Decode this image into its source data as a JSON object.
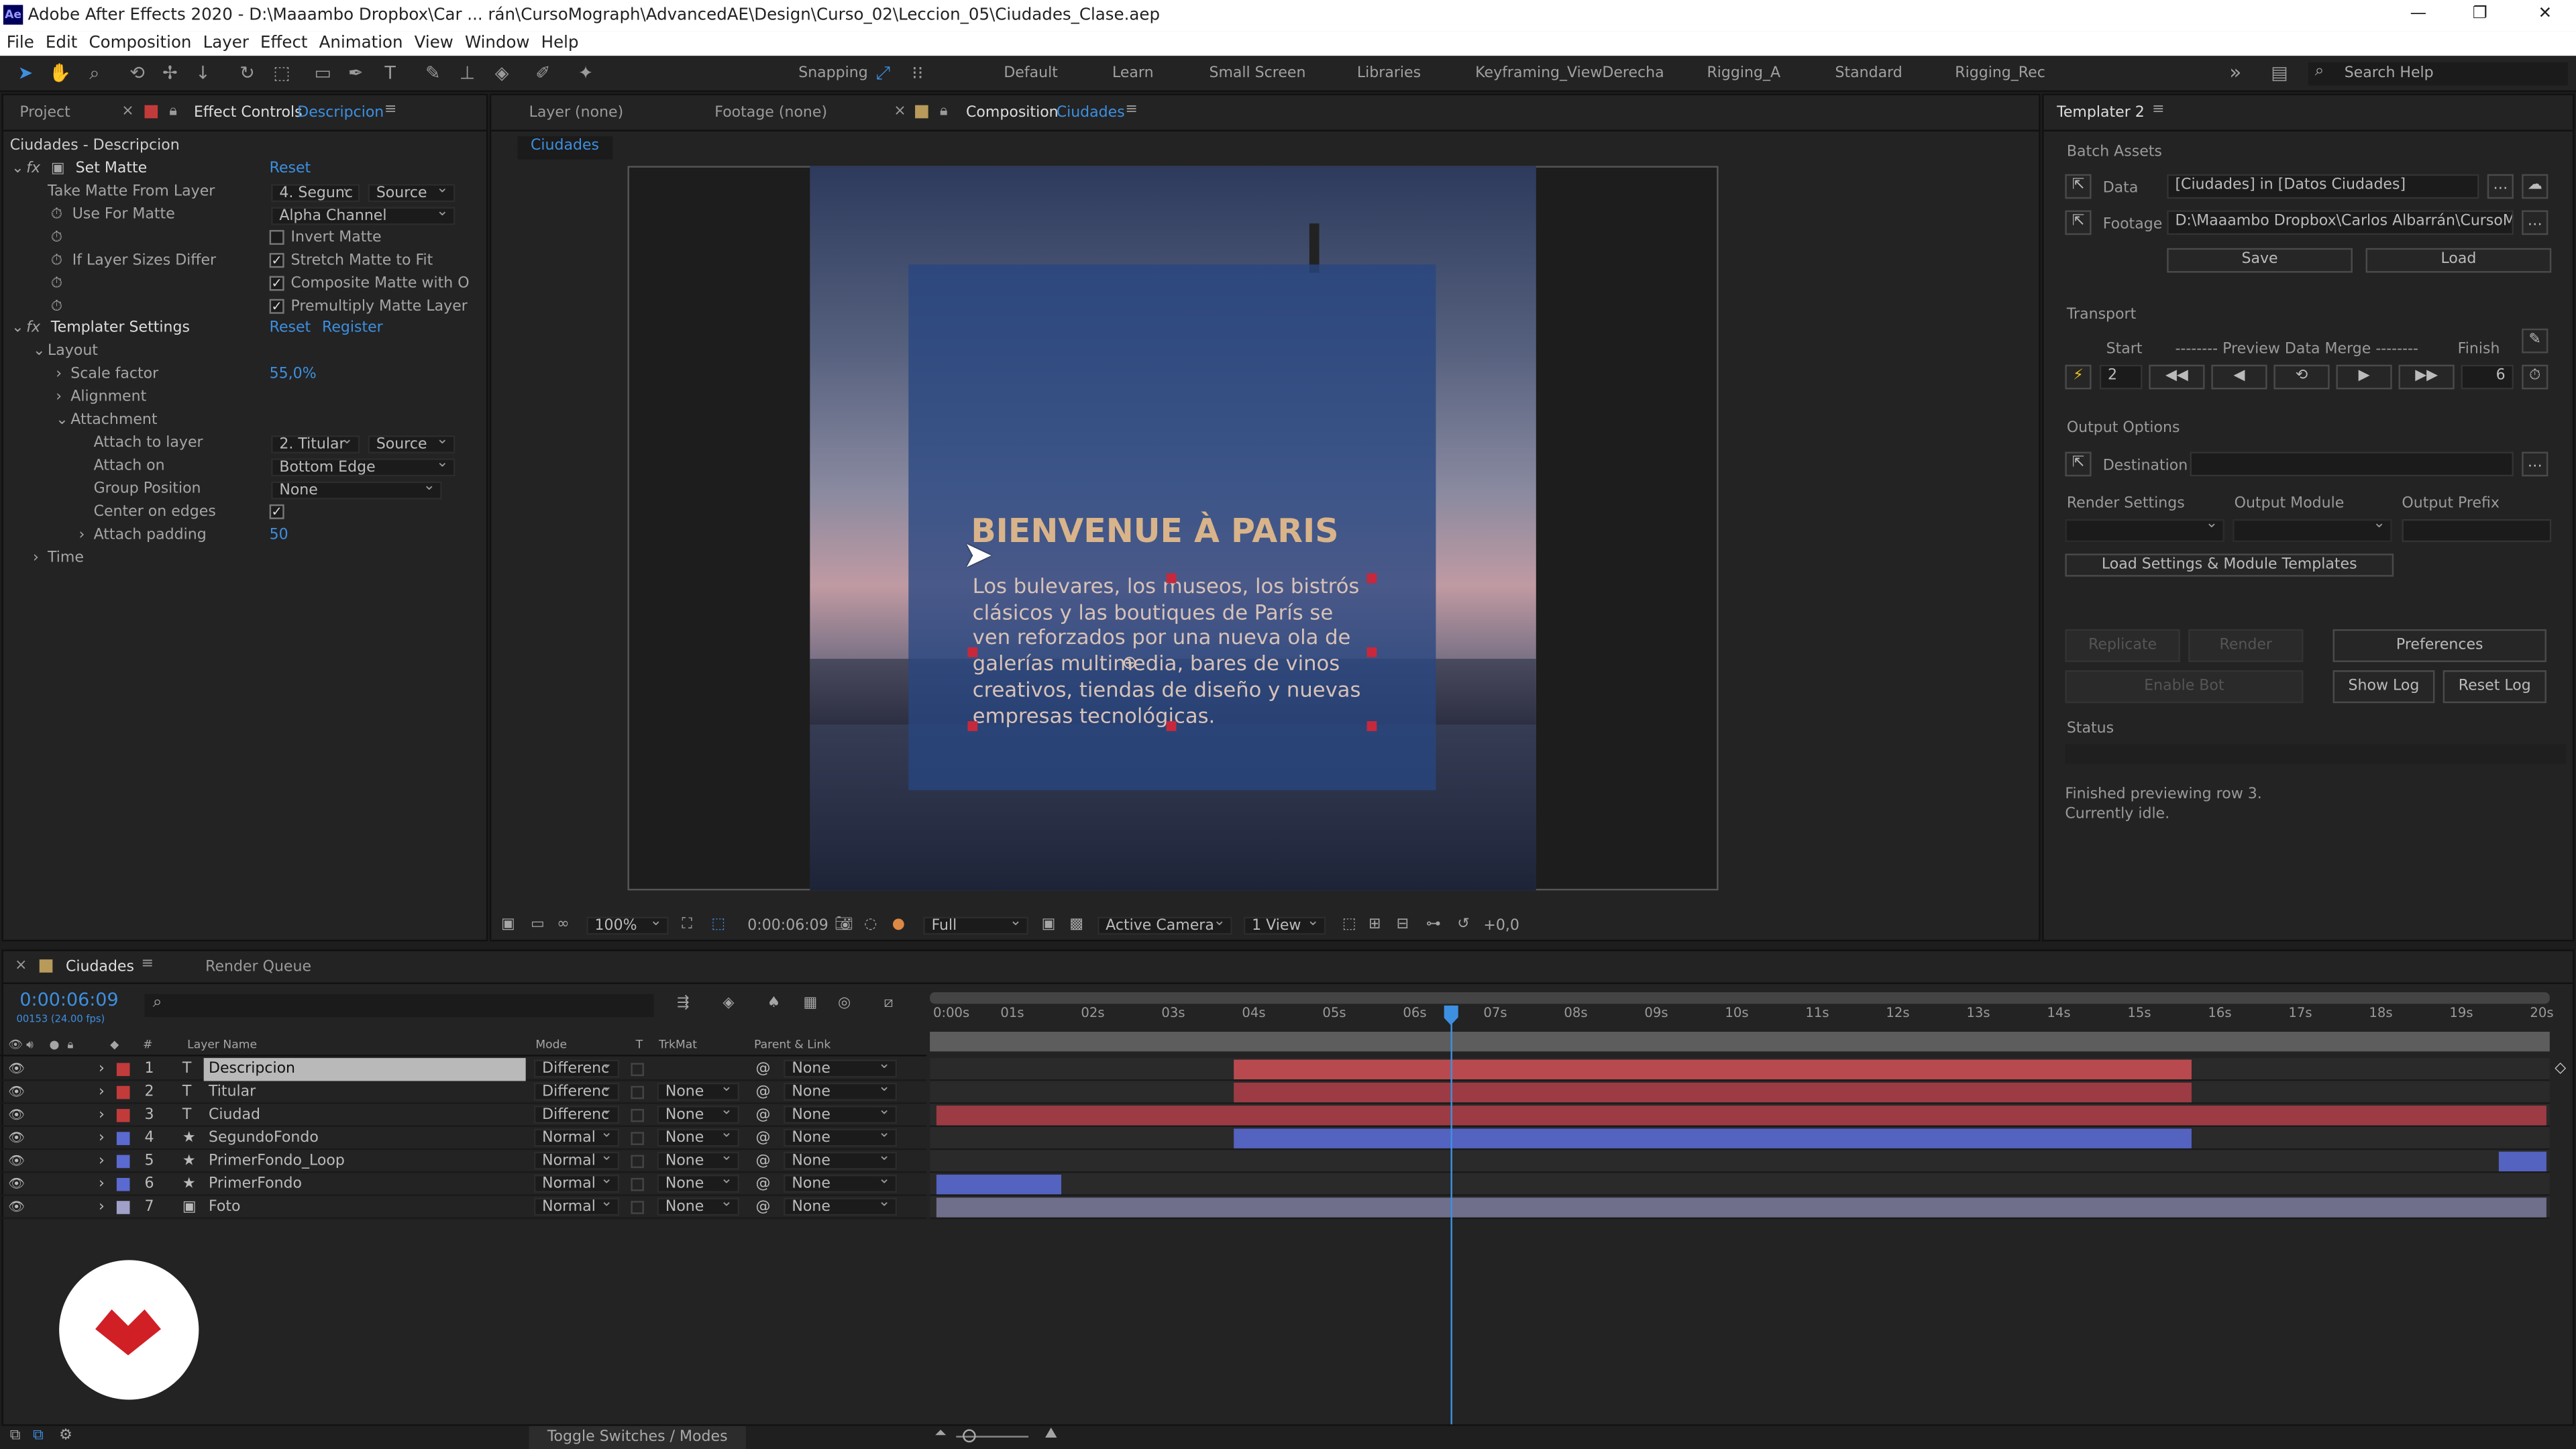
{
  "window": {
    "title": "Adobe After Effects 2020 - D:\\Maaambo Dropbox\\Car ... rán\\CursoMograph\\AdvancedAE\\Design\\Curso_02\\Leccion_05\\Ciudades_Clase.aep",
    "app_badge": "Ae",
    "min": "—",
    "max": "❐",
    "close": "✕"
  },
  "menu": [
    "File",
    "Edit",
    "Composition",
    "Layer",
    "Effect",
    "Animation",
    "View",
    "Window",
    "Help"
  ],
  "toolbar": {
    "snapping": "Snapping",
    "workspaces": [
      "Default",
      "Learn",
      "Small Screen",
      "Libraries",
      "Keyframing_ViewDerecha",
      "Rigging_A",
      "Standard",
      "Rigging_Rec"
    ],
    "more": "»",
    "search_placeholder": "Search Help"
  },
  "left_panel": {
    "tab_project": "Project",
    "tab_effect_controls": "Effect Controls",
    "tab_effect_target": "Descripcion",
    "breadcrumb": "Ciudades - Descripcion",
    "set_matte": {
      "fx": "fx",
      "name": "Set Matte",
      "reset": "Reset",
      "take_matte_label": "Take Matte From Layer",
      "take_matte_value": "4. Segunc",
      "take_matte_src": "Source",
      "use_for_matte_label": "Use For Matte",
      "use_for_matte_value": "Alpha Channel",
      "invert_matte": "Invert Matte",
      "if_layer_sizes": "If Layer Sizes Differ",
      "stretch": "Stretch Matte to Fit",
      "composite": "Composite Matte with O",
      "premultiply": "Premultiply Matte Layer"
    },
    "templater": {
      "fx": "fx",
      "name": "Templater Settings",
      "reset": "Reset",
      "register": "Register",
      "layout": "Layout",
      "scale_label": "Scale factor",
      "scale_value": "55,0%",
      "alignment": "Alignment",
      "attachment": "Attachment",
      "attach_to_label": "Attach to layer",
      "attach_to_value": "2. Titular",
      "attach_to_src": "Source",
      "attach_on_label": "Attach on",
      "attach_on_value": "Bottom Edge",
      "group_label": "Group Position",
      "group_value": "None",
      "center_label": "Center on edges",
      "padding_label": "Attach padding",
      "padding_value": "50",
      "time": "Time"
    }
  },
  "viewer": {
    "tab_layer": "Layer  (none)",
    "tab_footage": "Footage  (none)",
    "tab_comp": "Composition",
    "comp_name": "Ciudades",
    "comp_subtab": "Ciudades",
    "headline": "BIENVENUE À PARIS",
    "body": "Los bulevares, los museos, los bistrós clásicos y las boutiques de París se ven reforzados por una nueva ola de galerías multimedia, bares de vinos creativos, tiendas de diseño y nuevas empresas tecnológicas.",
    "zoom": "100%",
    "timecode": "0:00:06:09",
    "quality": "Full",
    "camera": "Active Camera",
    "views": "1 View",
    "exposure": "+0,0"
  },
  "templater_panel": {
    "title": "Templater 2",
    "batch_assets": "Batch Assets",
    "data_label": "Data",
    "data_value": "[Ciudades] in [Datos Ciudades]",
    "footage_label": "Footage",
    "footage_value": "D:\\Maaambo Dropbox\\Carlos Albarrán\\CursoMogra",
    "save": "Save",
    "load": "Load",
    "transport": "Transport",
    "start": "Start",
    "preview_label": "-------- Preview Data Merge --------",
    "finish": "Finish",
    "start_value": "2",
    "finish_value": "6",
    "output_options": "Output Options",
    "destination": "Destination",
    "render_settings": "Render Settings",
    "output_module": "Output Module",
    "output_prefix": "Output Prefix",
    "load_settings": "Load Settings & Module Templates",
    "replicate": "Replicate",
    "render": "Render",
    "preferences": "Preferences",
    "enable_bot": "Enable Bot",
    "show_log": "Show Log",
    "reset_log": "Reset Log",
    "status": "Status",
    "status_line1": "Finished previewing row 3.",
    "status_line2": "Currently idle."
  },
  "timeline": {
    "tab_comp": "Ciudades",
    "tab_render": "Render Queue",
    "timecode": "0:00:06:09",
    "fps": "00153 (24.00 fps)",
    "col_layer": "Layer Name",
    "col_mode": "Mode",
    "col_t": "T",
    "col_trkmat": "TrkMat",
    "col_parent": "Parent & Link",
    "col_num": "#",
    "toggle": "Toggle Switches / Modes",
    "ticks": [
      "0:00s",
      "01s",
      "02s",
      "03s",
      "04s",
      "05s",
      "06s",
      "07s",
      "08s",
      "09s",
      "10s",
      "11s",
      "12s",
      "13s",
      "14s",
      "15s",
      "16s",
      "17s",
      "18s",
      "19s",
      "20s"
    ],
    "layers": [
      {
        "num": "1",
        "type": "T",
        "name": "Descripcion",
        "mode": "Differenc",
        "trkmat": "",
        "parent": "None",
        "color": "#c23b3b",
        "bar_color": "#b84a4f",
        "start": 3.7,
        "end": 15.6
      },
      {
        "num": "2",
        "type": "T",
        "name": "Titular",
        "mode": "Differenc",
        "trkmat": "None",
        "parent": "None",
        "color": "#c23b3b",
        "bar_color": "#9c3b43",
        "start": 3.7,
        "end": 15.6
      },
      {
        "num": "3",
        "type": "T",
        "name": "Ciudad",
        "mode": "Differenc",
        "trkmat": "None",
        "parent": "None",
        "color": "#c23b3b",
        "bar_color": "#9c3b43",
        "start": 0,
        "end": 20
      },
      {
        "num": "4",
        "type": "★",
        "name": "SegundoFondo",
        "mode": "Normal",
        "trkmat": "None",
        "parent": "None",
        "color": "#5a6ad0",
        "bar_color": "#5462c0",
        "start": 3.7,
        "end": 15.6
      },
      {
        "num": "5",
        "type": "★",
        "name": "PrimerFondo_Loop",
        "mode": "Normal",
        "trkmat": "None",
        "parent": "None",
        "color": "#5a6ad0",
        "bar_color": "#5462c0",
        "start": 19.4,
        "end": 20
      },
      {
        "num": "6",
        "type": "★",
        "name": "PrimerFondo",
        "mode": "Normal",
        "trkmat": "None",
        "parent": "None",
        "color": "#5a6ad0",
        "bar_color": "#5462c0",
        "start": 0,
        "end": 1.55
      },
      {
        "num": "7",
        "type": "▣",
        "name": "Foto",
        "mode": "Normal",
        "trkmat": "None",
        "parent": "None",
        "color": "#a0a0c8",
        "bar_color": "#6f6f8c",
        "start": 0,
        "end": 20
      }
    ],
    "playhead": 6.38
  }
}
